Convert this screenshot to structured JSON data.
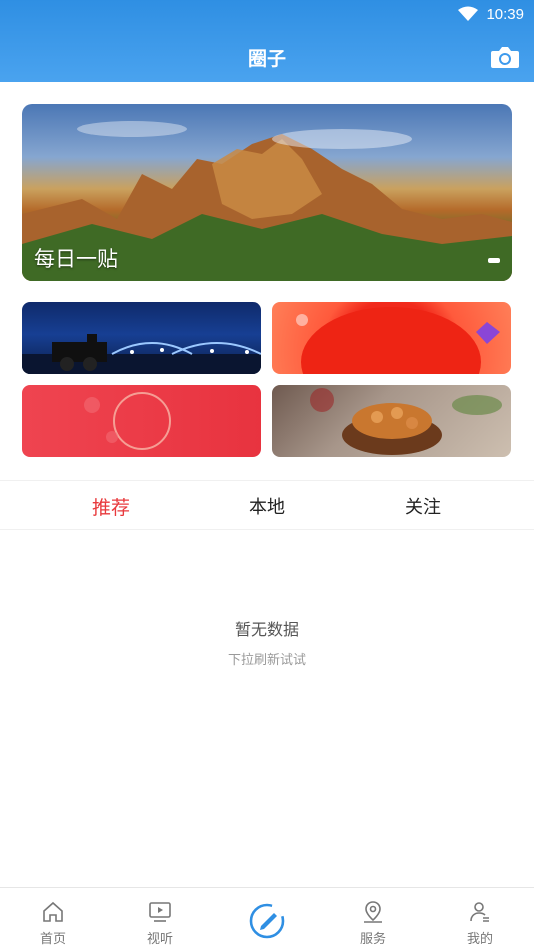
{
  "status_bar": {
    "time": "10:39",
    "wifi_icon": "wifi-icon"
  },
  "header": {
    "title": "圈子",
    "camera_icon": "camera-icon"
  },
  "banner": {
    "caption": "每日一贴"
  },
  "tabs": [
    {
      "label": "推荐",
      "active": true
    },
    {
      "label": "本地",
      "active": false
    },
    {
      "label": "关注",
      "active": false
    }
  ],
  "empty_state": {
    "title": "暂无数据",
    "subtitle": "下拉刷新试试"
  },
  "bottom_nav": [
    {
      "label": "首页",
      "icon": "home-icon"
    },
    {
      "label": "视听",
      "icon": "video-icon"
    },
    {
      "label": "",
      "icon": "circle-pen-icon"
    },
    {
      "label": "服务",
      "icon": "location-icon"
    },
    {
      "label": "我的",
      "icon": "user-icon"
    }
  ],
  "colors": {
    "header": "#3d9aed",
    "active_tab": "#e8393c"
  }
}
